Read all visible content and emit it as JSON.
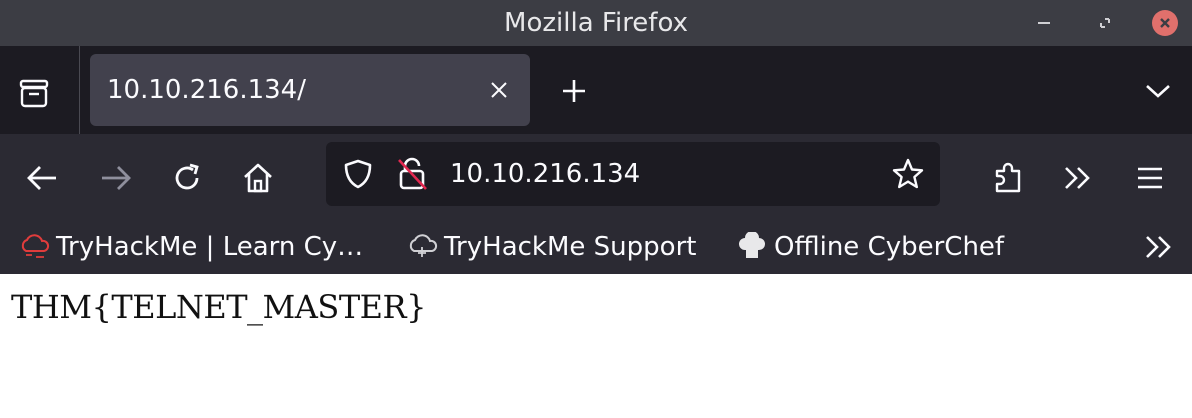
{
  "window": {
    "title": "Mozilla Firefox"
  },
  "tabs": [
    {
      "title": "10.10.216.134/",
      "active": true
    }
  ],
  "navbar": {
    "url": "10.10.216.134"
  },
  "bookmarks": [
    {
      "label": "TryHackMe | Learn Cy…",
      "icon": "thm-cloud-icon"
    },
    {
      "label": "TryHackMe Support",
      "icon": "thm-support-icon"
    },
    {
      "label": "Offline CyberChef",
      "icon": "chef-hat-icon"
    }
  ],
  "page": {
    "body_text": "THM{TELNET_MASTER}"
  },
  "colors": {
    "titlebar": "#3c3d44",
    "tabbar": "#1c1b22",
    "active_tab": "#42414d",
    "toolbar": "#2b2a33",
    "urlbar": "#1c1b22",
    "close_button": "#e0706c"
  }
}
